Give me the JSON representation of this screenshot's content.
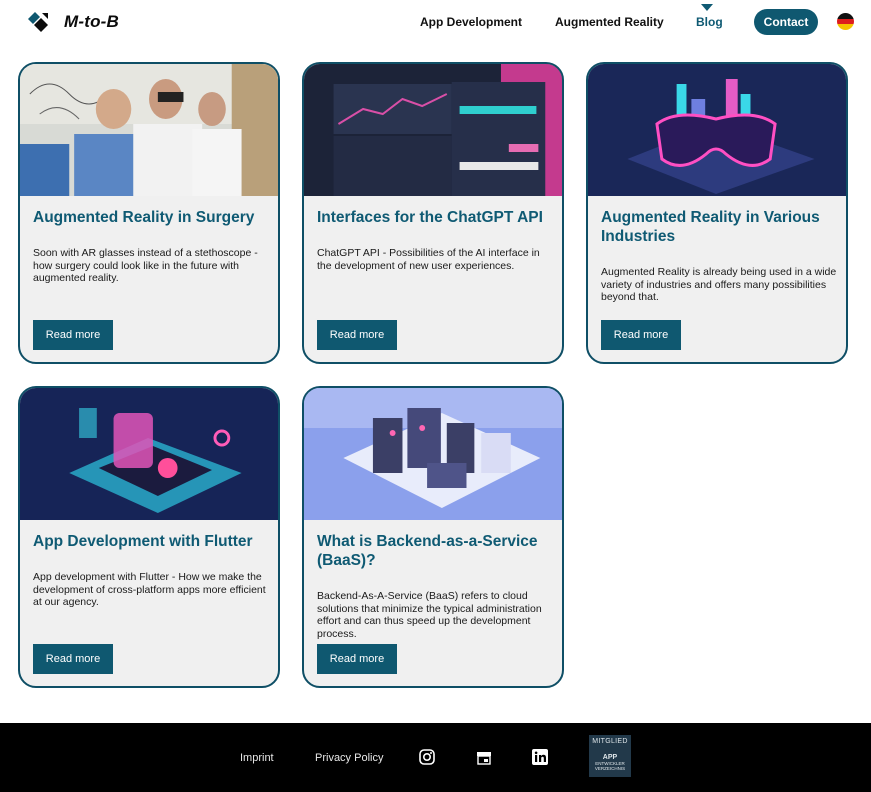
{
  "brand": {
    "name": "M-to-B"
  },
  "nav": {
    "items": [
      "App Development",
      "Augmented Reality",
      "Blog"
    ],
    "contact": "Contact"
  },
  "colors": {
    "primary": "#0f5870",
    "title": "#0f5a73",
    "card_bg": "#f0f0f0",
    "footer_bg": "#000000"
  },
  "cards": [
    {
      "title": "Augmented Reality in Surgery",
      "text": "Soon with AR glasses instead of a stethoscope - how surgery could look like in the future with augmented reality.",
      "button": "Read more",
      "image": "surgeons-ar-photo"
    },
    {
      "title": "Interfaces for the ChatGPT API",
      "text": "ChatGPT API - Possibilities of the AI interface in the development of new user experiences.",
      "button": "Read more",
      "image": "dashboard-ui-photo"
    },
    {
      "title": "Augmented Reality in Various Industries",
      "text": "Augmented Reality is already being used in a wide variety of industries and offers many possibilities beyond that.",
      "button": "Read more",
      "image": "ar-glasses-city-illustration"
    },
    {
      "title": "App Development with Flutter",
      "text": "App development with Flutter - How we make the development of cross-platform apps more efficient at our agency.",
      "button": "Read more",
      "image": "smartphone-neon-illustration"
    },
    {
      "title": "What is Backend-as-a-Service (BaaS)?",
      "text": "Backend-As-A-Service (BaaS) refers to cloud solutions that minimize the typical administration effort and can thus speed up the development process.",
      "button": "Read more",
      "image": "server-room-illustration"
    }
  ],
  "footer": {
    "links": [
      "Imprint",
      "Privacy Policy"
    ],
    "icons": [
      "instagram-icon",
      "store-icon",
      "linkedin-icon"
    ],
    "badge": {
      "line1": "MITGLIED",
      "line2": "APP",
      "line3": "ENTWICKLER",
      "line4": "VERZEICHNIS"
    }
  }
}
